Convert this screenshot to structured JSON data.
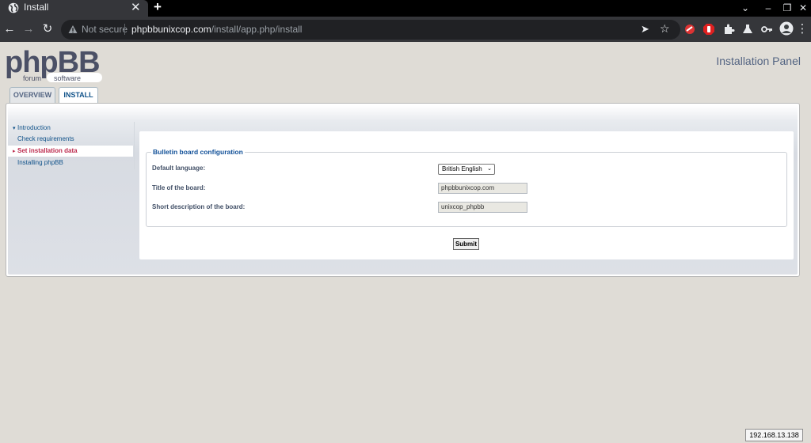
{
  "browser": {
    "tab_title": "Install",
    "not_secure": "Not secure",
    "url_domain": "phpbbunixcop.com",
    "url_path": "/install/app.php/install"
  },
  "logo": {
    "main": "phpBB",
    "tagline_1": "forum",
    "tagline_2": "software"
  },
  "panel_title": "Installation Panel",
  "tabs": [
    {
      "label": "Overview"
    },
    {
      "label": "Install"
    }
  ],
  "menu": [
    {
      "label": "Introduction"
    },
    {
      "label": "Check requirements"
    },
    {
      "label": "Set installation data"
    },
    {
      "label": "Installing phpBB"
    }
  ],
  "form": {
    "legend": "Bulletin board configuration",
    "language_label": "Default language:",
    "language_value": "British English",
    "title_label": "Title of the board:",
    "title_value": "phpbbunixcop.com",
    "desc_label": "Short description of the board:",
    "desc_value": "unixcop_phpbb",
    "submit": "Submit"
  },
  "status_ip": "192.168.13.138"
}
